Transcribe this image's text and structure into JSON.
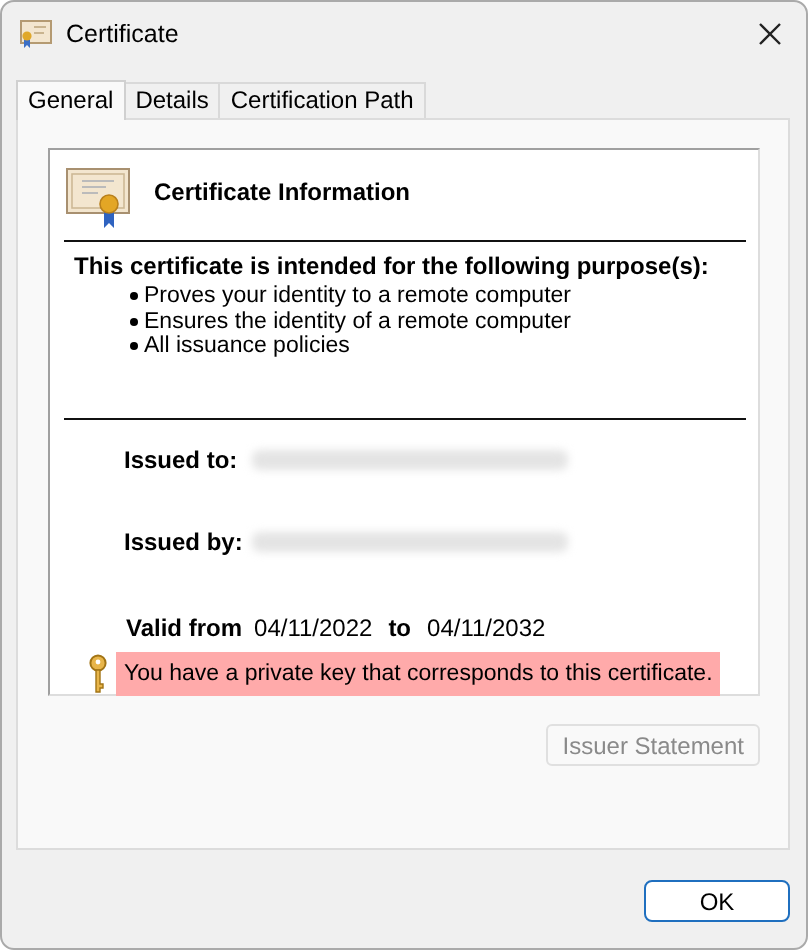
{
  "window": {
    "title": "Certificate"
  },
  "tabs": [
    {
      "label": "General",
      "selected": true
    },
    {
      "label": "Details",
      "selected": false
    },
    {
      "label": "Certification Path",
      "selected": false
    }
  ],
  "info": {
    "heading": "Certificate Information",
    "purpose_heading": "This certificate is intended for the following purpose(s):",
    "purposes": [
      "Proves your identity to a remote computer",
      "Ensures the identity of a remote computer",
      "All issuance policies"
    ],
    "issued_to_label": "Issued to:",
    "issued_by_label": "Issued by:",
    "valid_from_label": "Valid from",
    "valid_from": "04/11/2022",
    "valid_to_label": "to",
    "valid_to": "04/11/2032",
    "key_note": {
      "text": "You have a private key that corresponds to this certificate.",
      "highlighted": true
    }
  },
  "issuer_statement_button": {
    "label": "Issuer Statement",
    "disabled": true
  },
  "buttons": [
    "OK"
  ]
}
